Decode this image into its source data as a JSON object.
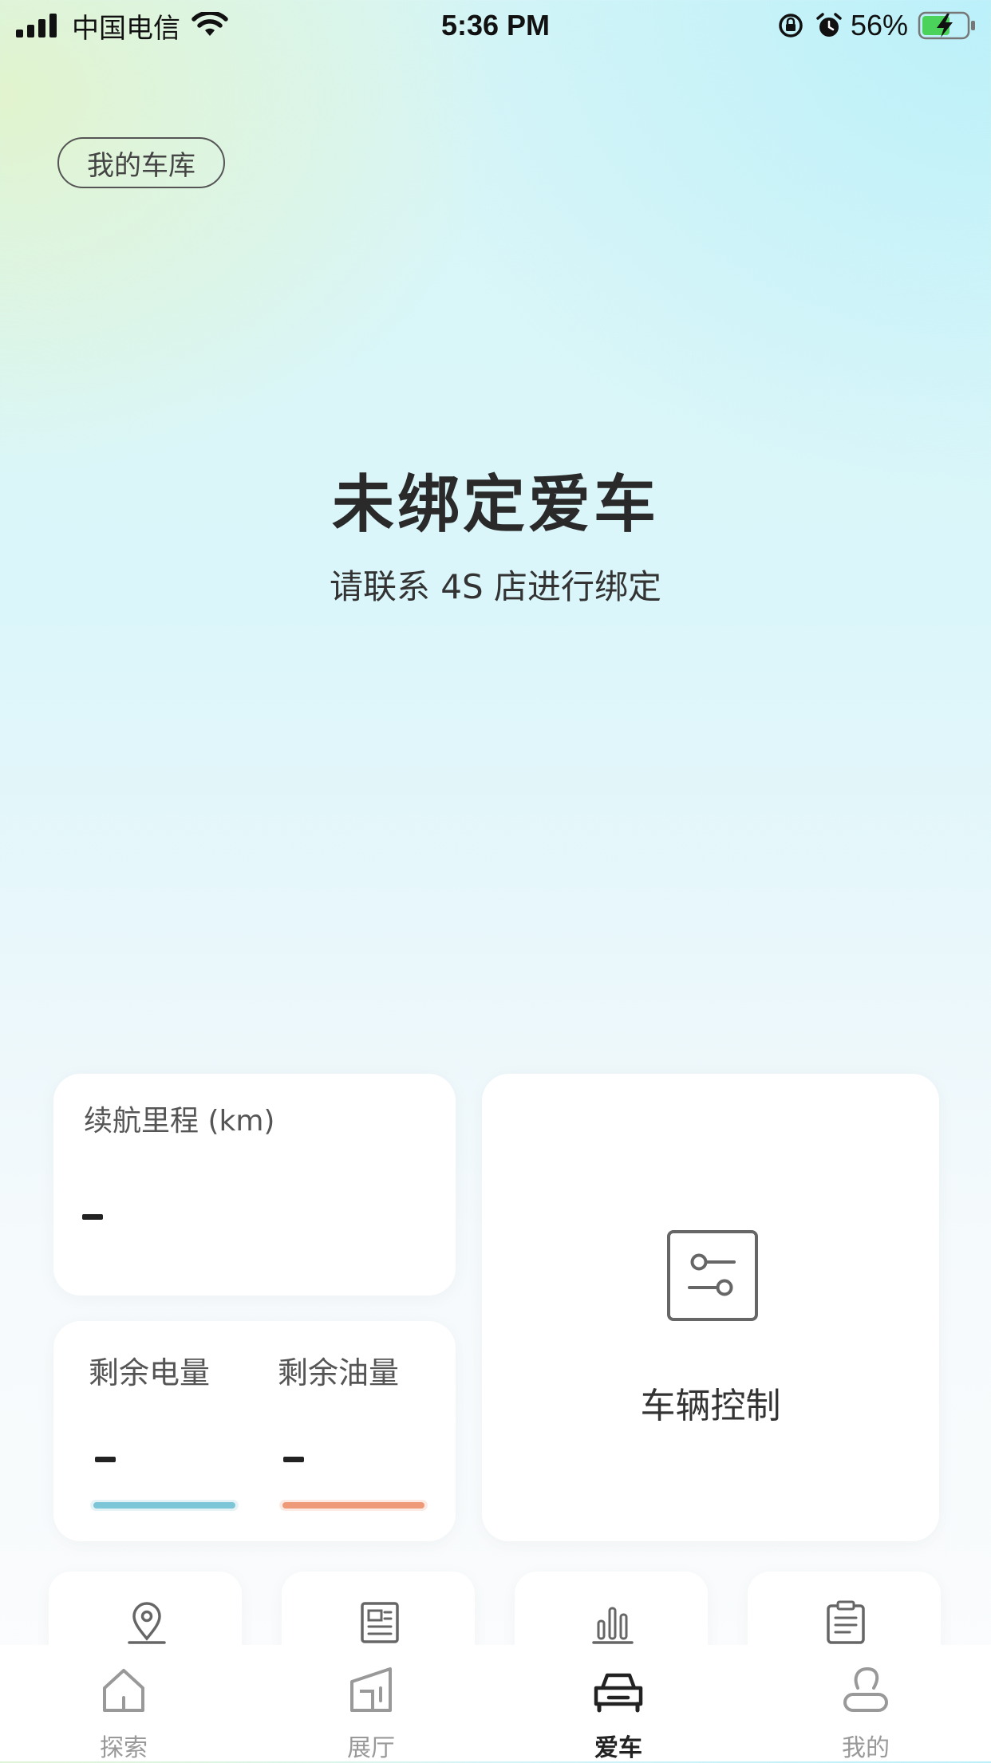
{
  "status_bar": {
    "carrier": "中国电信",
    "time": "5:36 PM",
    "battery": "56%",
    "icons": [
      "signal-icon",
      "wifi-icon",
      "rotation-lock-icon",
      "alarm-icon",
      "battery-charging-icon"
    ]
  },
  "header": {
    "garage_button": "我的车库"
  },
  "hero": {
    "title": "未绑定爱车",
    "subtitle": "请联系 4S 店进行绑定"
  },
  "range_card": {
    "label": "续航里程 (km)",
    "value": "-"
  },
  "levels_card": {
    "battery_label": "剩余电量",
    "battery_value": "-",
    "battery_color": "#7cc6d8",
    "fuel_label": "剩余油量",
    "fuel_value": "-",
    "fuel_color": "#ee9a78"
  },
  "control_card": {
    "label": "车辆控制",
    "icon": "sliders-icon"
  },
  "shortcuts": [
    {
      "icon": "location-pin-icon"
    },
    {
      "icon": "news-icon"
    },
    {
      "icon": "bar-chart-icon"
    },
    {
      "icon": "clipboard-icon"
    }
  ],
  "tabbar": {
    "items": [
      {
        "label": "探索",
        "icon": "home-icon",
        "active": false
      },
      {
        "label": "展厅",
        "icon": "showroom-icon",
        "active": false
      },
      {
        "label": "爱车",
        "icon": "car-icon",
        "active": true
      },
      {
        "label": "我的",
        "icon": "profile-icon",
        "active": false
      }
    ]
  }
}
